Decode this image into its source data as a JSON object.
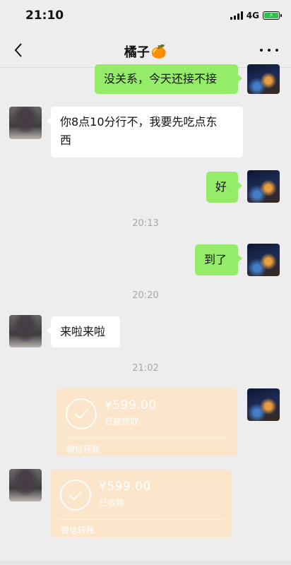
{
  "status_bar": {
    "time": "21:10",
    "network": "4G",
    "battery_icon": "charging-battery-icon"
  },
  "nav": {
    "title": "橘子",
    "title_emoji": "🍊",
    "back_icon": "chevron-left-icon",
    "more_icon": "more-dots-icon"
  },
  "messages": [
    {
      "sender": "self",
      "text": "没关系，今天还接不接"
    },
    {
      "sender": "other",
      "text_line1": "你8点10分行不，我要先吃点东",
      "text_line2": "西"
    },
    {
      "sender": "self",
      "text": "好"
    },
    {
      "timestamp": "20:13"
    },
    {
      "sender": "self",
      "text": "到了"
    },
    {
      "timestamp": "20:20"
    },
    {
      "sender": "other",
      "text": "来啦来啦"
    },
    {
      "timestamp": "21:02"
    }
  ],
  "transfers": [
    {
      "sender": "self",
      "amount": "¥599.00",
      "status": "已被领取",
      "footer": "微信转账"
    },
    {
      "sender": "other",
      "amount": "¥599.00",
      "status": "已收款",
      "footer": "微信转账"
    }
  ],
  "colors": {
    "background": "#ededed",
    "self_bubble": "#95ec69",
    "other_bubble": "#ffffff",
    "transfer": "#fbe5cb"
  }
}
